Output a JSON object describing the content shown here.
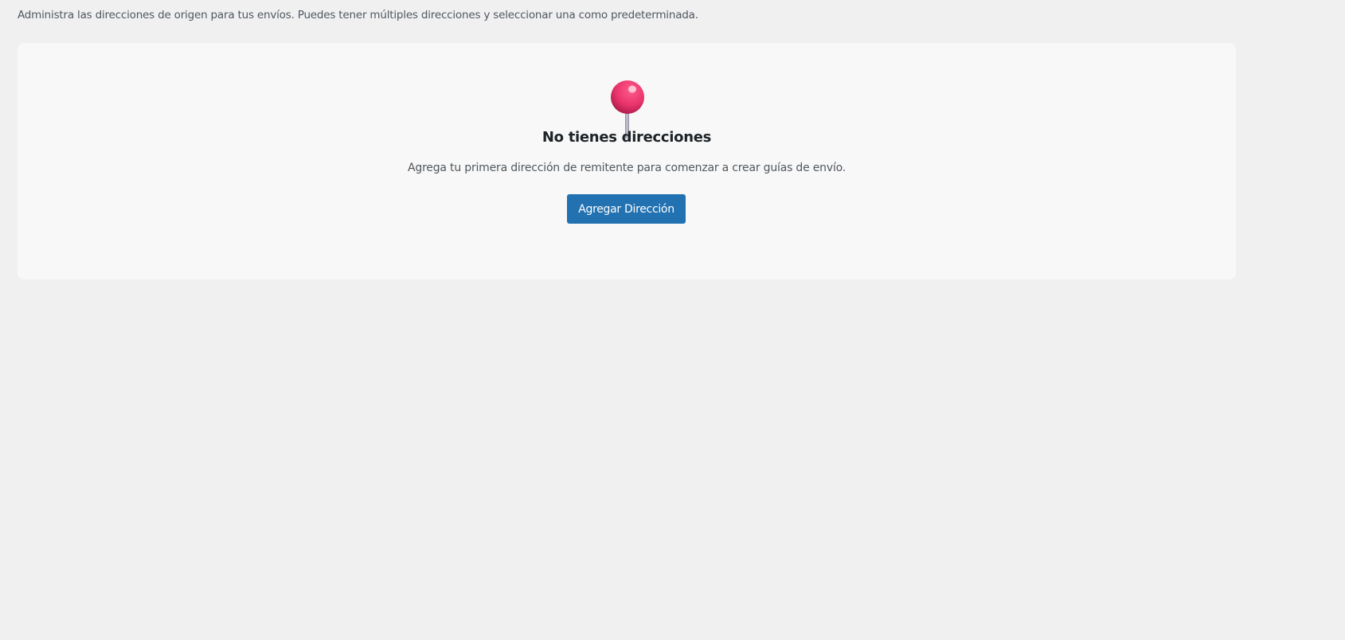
{
  "intro": "Administra las direcciones de origen para tus envíos. Puedes tener múltiples direcciones y seleccionar una como predeterminada.",
  "empty_state": {
    "icon": "round-pushpin-icon",
    "title": "No tienes direcciones",
    "description": "Agrega tu primera dirección de remitente para comenzar a crear guías de envío.",
    "button_label": "Agregar Dirección"
  },
  "colors": {
    "accent": "#2271b1",
    "pin": "#e8336b"
  }
}
